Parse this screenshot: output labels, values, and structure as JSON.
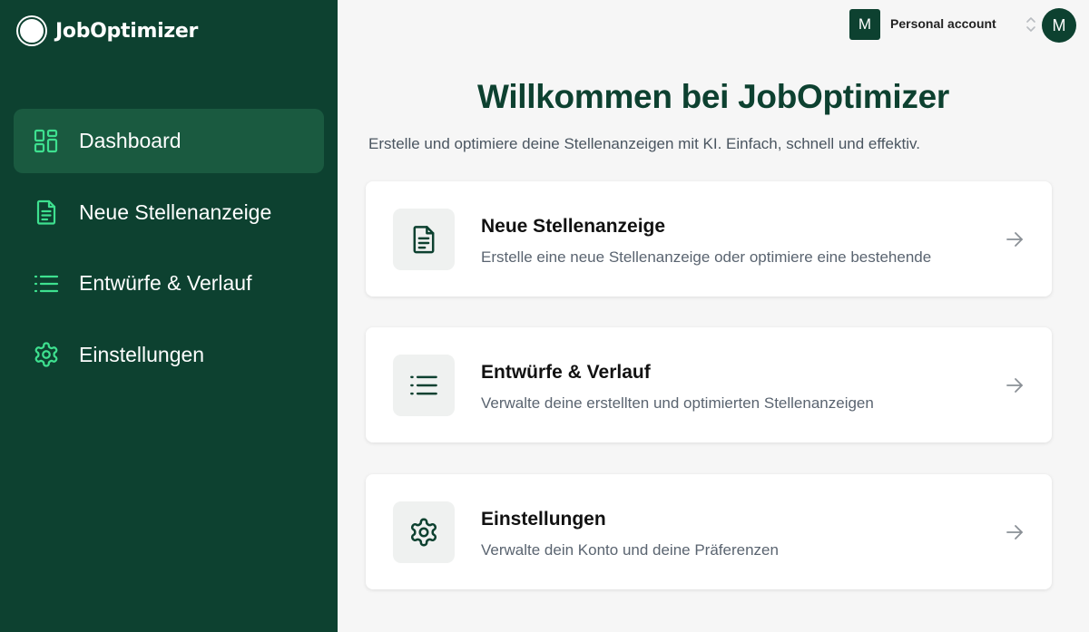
{
  "brand": {
    "name": "JobOptimizer"
  },
  "sidebar": {
    "items": [
      {
        "label": "Dashboard",
        "icon": "dashboard-grid-icon",
        "active": true
      },
      {
        "label": "Neue Stellenanzeige",
        "icon": "document-icon",
        "active": false
      },
      {
        "label": "Entwürfe & Verlauf",
        "icon": "list-icon",
        "active": false
      },
      {
        "label": "Einstellungen",
        "icon": "gear-icon",
        "active": false
      }
    ]
  },
  "header": {
    "account_badge": "M",
    "account_label": "Personal account",
    "avatar_initial": "M"
  },
  "main": {
    "title": "Willkommen bei JobOptimizer",
    "subtitle": "Erstelle und optimiere deine Stellenanzeigen mit KI. Einfach, schnell und effektiv.",
    "cards": [
      {
        "title": "Neue Stellenanzeige",
        "description": "Erstelle eine neue Stellenanzeige oder optimiere eine bestehende",
        "icon": "document-icon"
      },
      {
        "title": "Entwürfe & Verlauf",
        "description": "Verwalte deine erstellten und optimierten Stellenanzeigen",
        "icon": "list-icon"
      },
      {
        "title": "Einstellungen",
        "description": "Verwalte dein Konto und deine Präferenzen",
        "icon": "gear-icon"
      }
    ]
  },
  "colors": {
    "sidebar_bg": "#0d4130",
    "sidebar_active": "#1a5a40",
    "accent_icon": "#3ee08f",
    "title": "#0d4130"
  }
}
